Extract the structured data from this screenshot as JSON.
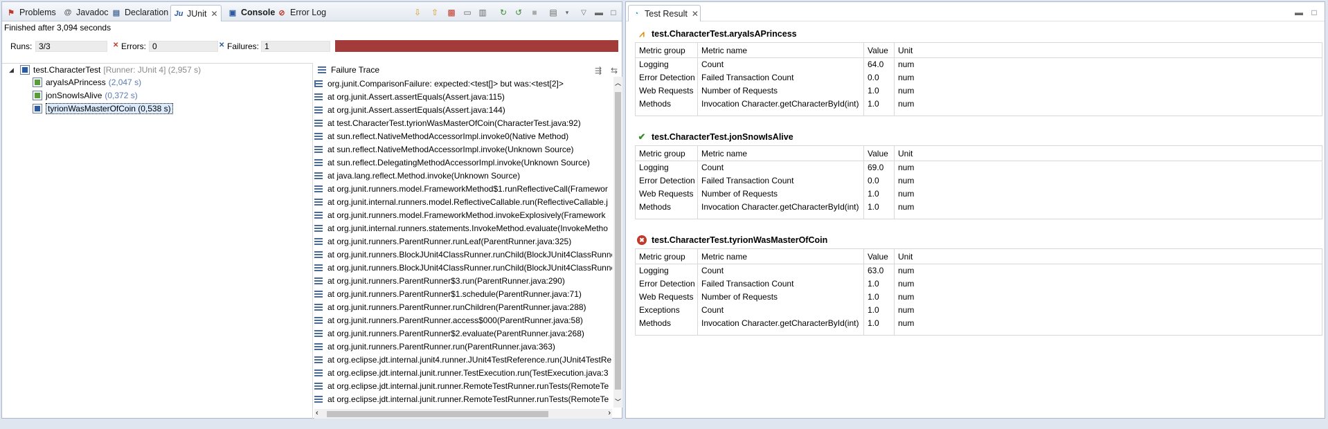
{
  "left_tabs": [
    {
      "label": "Problems",
      "icon": "problems-icon"
    },
    {
      "label": "Javadoc",
      "icon": "javadoc-icon"
    },
    {
      "label": "Declaration",
      "icon": "declaration-icon"
    },
    {
      "label": "JUnit",
      "icon": "junit-icon"
    },
    {
      "label": "Console",
      "icon": "console-icon"
    },
    {
      "label": "Error Log",
      "icon": "error-log-icon"
    }
  ],
  "junit": {
    "finished_text": "Finished after 3,094 seconds",
    "runs_label": "Runs:",
    "runs_value": "3/3",
    "errors_label": "Errors:",
    "errors_value": "0",
    "failures_label": "Failures:",
    "failures_value": "1",
    "progress_fraction": 1.0,
    "status_color": "#a33b3b"
  },
  "tree": {
    "root": {
      "label": "test.CharacterTest",
      "meta": "[Runner: JUnit 4] (2,957 s)"
    },
    "children": [
      {
        "label": "aryaIsAPrincess",
        "meta": "(2,047 s)"
      },
      {
        "label": "jonSnowIsAlive",
        "meta": "(0,372 s)"
      },
      {
        "label": "tyrionWasMasterOfCoin (0,538 s)",
        "meta": ""
      }
    ]
  },
  "failure_trace": {
    "title": "Failure Trace",
    "lines": [
      "org.junit.ComparisonFailure: expected:<test[]> but was:<test[2]>",
      "at org.junit.Assert.assertEquals(Assert.java:115)",
      "at org.junit.Assert.assertEquals(Assert.java:144)",
      "at test.CharacterTest.tyrionWasMasterOfCoin(CharacterTest.java:92)",
      "at sun.reflect.NativeMethodAccessorImpl.invoke0(Native Method)",
      "at sun.reflect.NativeMethodAccessorImpl.invoke(Unknown Source)",
      "at sun.reflect.DelegatingMethodAccessorImpl.invoke(Unknown Source)",
      "at java.lang.reflect.Method.invoke(Unknown Source)",
      "at org.junit.runners.model.FrameworkMethod$1.runReflectiveCall(Framewor",
      "at org.junit.internal.runners.model.ReflectiveCallable.run(ReflectiveCallable.j",
      "at org.junit.runners.model.FrameworkMethod.invokeExplosively(Framework",
      "at org.junit.internal.runners.statements.InvokeMethod.evaluate(InvokeMetho",
      "at org.junit.runners.ParentRunner.runLeaf(ParentRunner.java:325)",
      "at org.junit.runners.BlockJUnit4ClassRunner.runChild(BlockJUnit4ClassRunne",
      "at org.junit.runners.BlockJUnit4ClassRunner.runChild(BlockJUnit4ClassRunne",
      "at org.junit.runners.ParentRunner$3.run(ParentRunner.java:290)",
      "at org.junit.runners.ParentRunner$1.schedule(ParentRunner.java:71)",
      "at org.junit.runners.ParentRunner.runChildren(ParentRunner.java:288)",
      "at org.junit.runners.ParentRunner.access$000(ParentRunner.java:58)",
      "at org.junit.runners.ParentRunner$2.evaluate(ParentRunner.java:268)",
      "at org.junit.runners.ParentRunner.run(ParentRunner.java:363)",
      "at org.eclipse.jdt.internal.junit4.runner.JUnit4TestReference.run(JUnit4TestRe",
      "at org.eclipse.jdt.internal.junit.runner.TestExecution.run(TestExecution.java:3",
      "at org.eclipse.jdt.internal.junit.runner.RemoteTestRunner.runTests(RemoteTe",
      "at org.eclipse.jdt.internal.junit.runner.RemoteTestRunner.runTests(RemoteTe"
    ]
  },
  "right_tab": {
    "label": "Test Result",
    "icon": "test-result-icon"
  },
  "results": {
    "headers": {
      "group": "Metric group",
      "name": "Metric name",
      "value": "Value",
      "unit": "Unit"
    },
    "sections": [
      {
        "title": "test.CharacterTest.aryaIsAPrincess",
        "status_icon": "warning-chart-icon",
        "rows": [
          {
            "group": "Logging",
            "name": "Count",
            "value": "64.0",
            "unit": "num"
          },
          {
            "group": "Error Detection",
            "name": "Failed Transaction Count",
            "value": "0.0",
            "unit": "num"
          },
          {
            "group": "Web Requests",
            "name": "Number of Requests",
            "value": "1.0",
            "unit": "num"
          },
          {
            "group": "Methods",
            "name": "Invocation Character.getCharacterById(int)",
            "value": "1.0",
            "unit": "num"
          }
        ]
      },
      {
        "title": "test.CharacterTest.jonSnowIsAlive",
        "status_icon": "check-icon",
        "rows": [
          {
            "group": "Logging",
            "name": "Count",
            "value": "69.0",
            "unit": "num"
          },
          {
            "group": "Error Detection",
            "name": "Failed Transaction Count",
            "value": "0.0",
            "unit": "num"
          },
          {
            "group": "Web Requests",
            "name": "Number of Requests",
            "value": "1.0",
            "unit": "num"
          },
          {
            "group": "Methods",
            "name": "Invocation Character.getCharacterById(int)",
            "value": "1.0",
            "unit": "num"
          }
        ]
      },
      {
        "title": "test.CharacterTest.tyrionWasMasterOfCoin",
        "status_icon": "error-icon",
        "rows": [
          {
            "group": "Logging",
            "name": "Count",
            "value": "63.0",
            "unit": "num"
          },
          {
            "group": "Error Detection",
            "name": "Failed Transaction Count",
            "value": "1.0",
            "unit": "num"
          },
          {
            "group": "Web Requests",
            "name": "Number of Requests",
            "value": "1.0",
            "unit": "num"
          },
          {
            "group": "Exceptions",
            "name": "Count",
            "value": "1.0",
            "unit": "num"
          },
          {
            "group": "Methods",
            "name": "Invocation Character.getCharacterById(int)",
            "value": "1.0",
            "unit": "num"
          }
        ]
      }
    ]
  },
  "colors": {
    "accent": "#2c5aa0",
    "failure": "#a33b3b",
    "success": "#3a8a2e",
    "warning": "#e08a00"
  }
}
